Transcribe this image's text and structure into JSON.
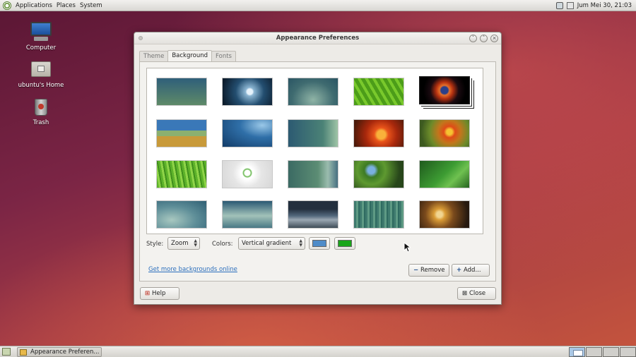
{
  "top_panel": {
    "menus": [
      "Applications",
      "Places",
      "System"
    ],
    "clock": "Jum Mei 30, 21:03"
  },
  "desktop": {
    "icons": [
      {
        "label": "Computer",
        "icon": "computer-icon"
      },
      {
        "label": "ubuntu's Home",
        "icon": "home-folder-icon"
      },
      {
        "label": "Trash",
        "icon": "trash-icon"
      }
    ]
  },
  "window": {
    "title": "Appearance Preferences",
    "tabs": [
      "Theme",
      "Background",
      "Fonts"
    ],
    "active_tab": "Background",
    "style_label": "Style:",
    "style_value": "Zoom",
    "colors_label": "Colors:",
    "colors_value": "Vertical gradient",
    "primary_color": "#4f8cc9",
    "secondary_color": "#1aa51a",
    "link": "Get more backgrounds online",
    "remove_label": "Remove",
    "add_label": "Add...",
    "help_label": "Help",
    "close_label": "Close"
  },
  "taskbar": {
    "task_label": "Appearance Preferen..."
  }
}
